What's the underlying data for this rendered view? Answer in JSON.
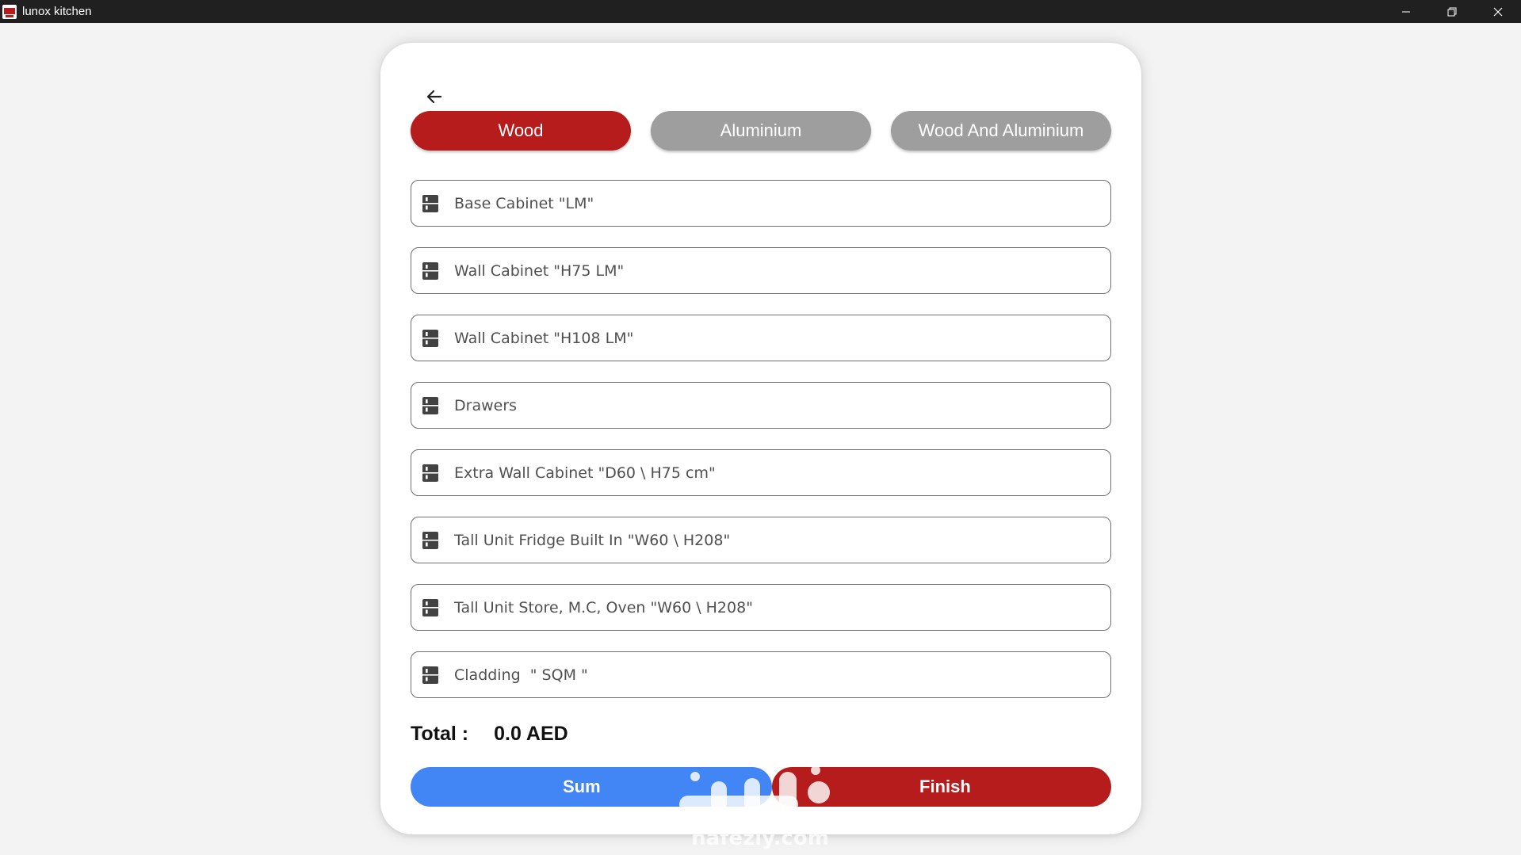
{
  "window": {
    "title": "lunox kitchen"
  },
  "tabs": [
    {
      "label": "Wood",
      "active": true
    },
    {
      "label": "Aluminium",
      "active": false
    },
    {
      "label": "Wood And Aluminium",
      "active": false
    }
  ],
  "fields": [
    {
      "label": "Base Cabinet \"LM\""
    },
    {
      "label": "Wall Cabinet \"H75 LM\""
    },
    {
      "label": "Wall Cabinet \"H108 LM\""
    },
    {
      "label": "Drawers"
    },
    {
      "label": "Extra Wall Cabinet \"D60 \\ H75 cm\""
    },
    {
      "label": "Tall Unit Fridge Built In \"W60 \\ H208\""
    },
    {
      "label": "Tall Unit Store, M.C, Oven \"W60 \\ H208\""
    },
    {
      "label": "Cladding  \" SQM \""
    }
  ],
  "total": {
    "label": "Total :",
    "value": "0.0 AED"
  },
  "buttons": {
    "sum": "Sum",
    "finish": "Finish"
  },
  "colors": {
    "accent_red": "#b71c1c",
    "accent_blue": "#4285f4",
    "inactive_tab": "#9e9e9e",
    "titlebar": "#202020"
  },
  "icons": {
    "app": "app-logo-icon",
    "back": "arrow-back-icon",
    "field": "cabinet-icon",
    "minimize": "minimize-icon",
    "restore": "restore-icon",
    "close": "close-icon"
  },
  "watermark": {
    "text": "nafezly.com"
  }
}
